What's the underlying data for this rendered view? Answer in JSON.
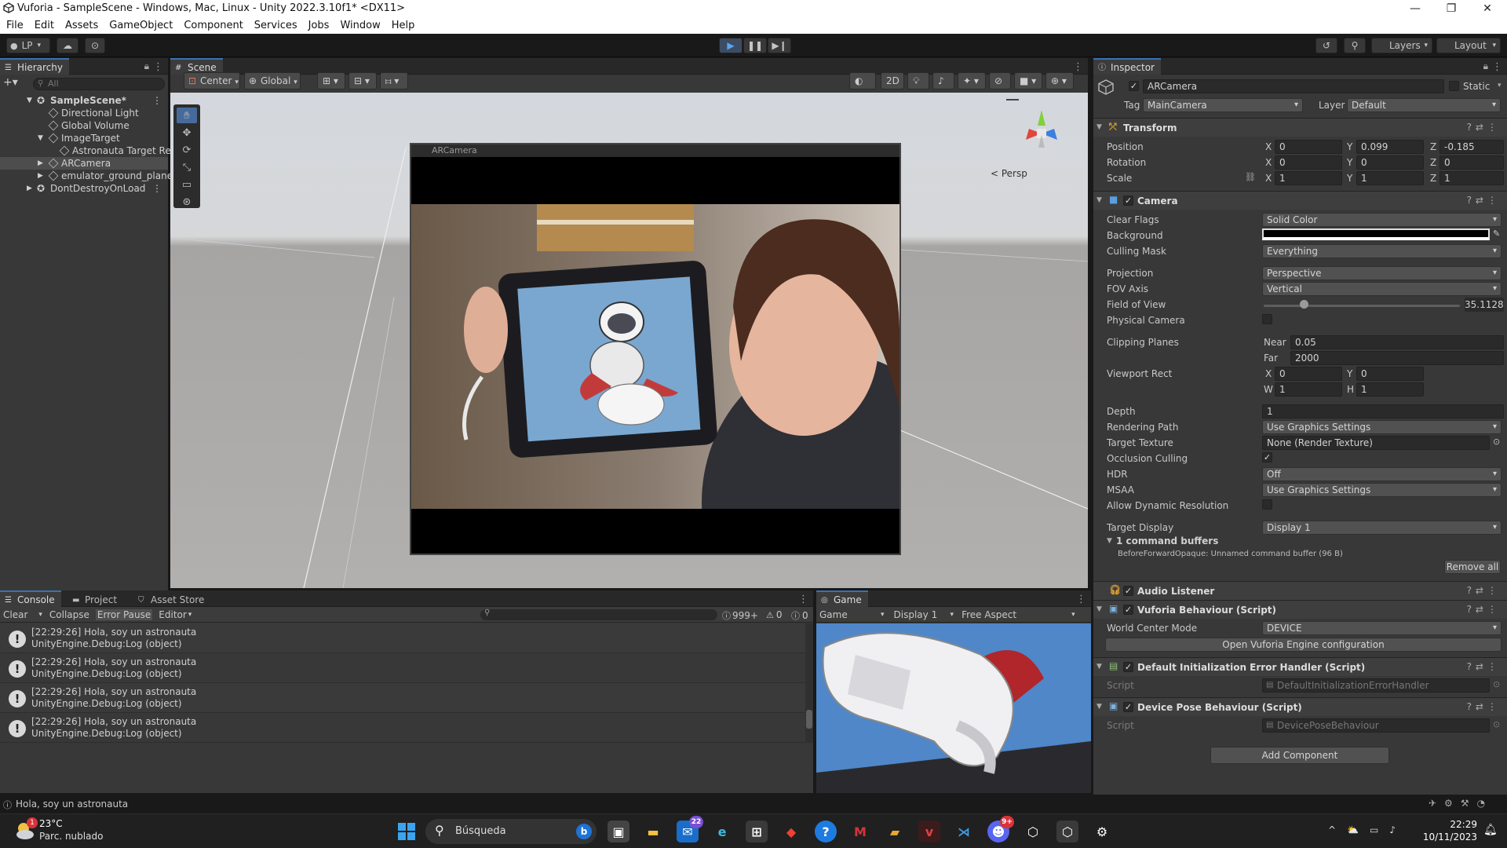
{
  "window": {
    "title": "Vuforia - SampleScene - Windows, Mac, Linux - Unity 2022.3.10f1* <DX11>"
  },
  "menu": [
    "File",
    "Edit",
    "Assets",
    "GameObject",
    "Component",
    "Services",
    "Jobs",
    "Window",
    "Help"
  ],
  "toolbar": {
    "account": "LP",
    "layers": "Layers",
    "layout": "Layout"
  },
  "hierarchy": {
    "tab": "Hierarchy",
    "search_placeholder": "All",
    "items": [
      {
        "label": "SampleScene*"
      },
      {
        "label": "Directional Light"
      },
      {
        "label": "Global Volume"
      },
      {
        "label": "ImageTarget"
      },
      {
        "label": "Astronauta Target Re"
      },
      {
        "label": "ARCamera"
      },
      {
        "label": "emulator_ground_plane"
      },
      {
        "label": "DontDestroyOnLoad"
      }
    ]
  },
  "scene": {
    "tab": "Scene",
    "pivot": "Center",
    "space": "Global",
    "mode2d": "2D",
    "persp": "< Persp",
    "camera_preview_title": "ARCamera"
  },
  "inspector": {
    "tab": "Inspector",
    "object_name": "ARCamera",
    "static_label": "Static",
    "tag_label": "Tag",
    "tag_value": "MainCamera",
    "layer_label": "Layer",
    "layer_value": "Default",
    "transform": {
      "title": "Transform",
      "position_label": "Position",
      "rotation_label": "Rotation",
      "scale_label": "Scale",
      "position": {
        "x": "0",
        "y": "0.099",
        "z": "-0.185"
      },
      "rotation": {
        "x": "0",
        "y": "0",
        "z": "0"
      },
      "scale": {
        "x": "1",
        "y": "1",
        "z": "1"
      }
    },
    "camera": {
      "title": "Camera",
      "clear_flags_label": "Clear Flags",
      "clear_flags": "Solid Color",
      "background_label": "Background",
      "culling_mask_label": "Culling Mask",
      "culling_mask": "Everything",
      "projection_label": "Projection",
      "projection": "Perspective",
      "fov_axis_label": "FOV Axis",
      "fov_axis": "Vertical",
      "fov_label": "Field of View",
      "fov": "35.1128",
      "physical_label": "Physical Camera",
      "clipping_label": "Clipping Planes",
      "near_label": "Near",
      "near": "0.05",
      "far_label": "Far",
      "far": "2000",
      "viewport_label": "Viewport Rect",
      "vx": "0",
      "vy": "0",
      "vw": "1",
      "vh": "1",
      "depth_label": "Depth",
      "depth": "1",
      "render_path_label": "Rendering Path",
      "render_path": "Use Graphics Settings",
      "target_texture_label": "Target Texture",
      "target_texture": "None (Render Texture)",
      "occlusion_label": "Occlusion Culling",
      "hdr_label": "HDR",
      "hdr": "Off",
      "msaa_label": "MSAA",
      "msaa": "Use Graphics Settings",
      "dynamic_res_label": "Allow Dynamic Resolution",
      "target_display_label": "Target Display",
      "target_display": "Display 1",
      "cmd_buffers": "1 command buffers",
      "cmd_buffer_item": "BeforeForwardOpaque: Unnamed command buffer (96 B)",
      "remove_all": "Remove all"
    },
    "audio_listener": "Audio Listener",
    "vuforia": {
      "title": "Vuforia Behaviour (Script)",
      "wcm_label": "World Center Mode",
      "wcm": "DEVICE",
      "open_config": "Open Vuforia Engine configuration"
    },
    "error_handler": {
      "title": "Default Initialization Error Handler (Script)",
      "script_label": "Script",
      "script": "DefaultInitializationErrorHandler"
    },
    "device_pose": {
      "title": "Device Pose Behaviour (Script)",
      "script_label": "Script",
      "script": "DevicePoseBehaviour"
    },
    "add_component": "Add Component"
  },
  "console": {
    "tabs": [
      "Console",
      "Project",
      "Asset Store"
    ],
    "toolbar": {
      "clear": "Clear",
      "collapse": "Collapse",
      "error_pause": "Error Pause",
      "editor": "Editor"
    },
    "counts": {
      "logs": "999+",
      "warnings": "0",
      "errors": "0"
    },
    "entries": [
      {
        "line1": "[22:29:26] Hola, soy un astronauta",
        "line2": "UnityEngine.Debug:Log (object)"
      },
      {
        "line1": "[22:29:26] Hola, soy un astronauta",
        "line2": "UnityEngine.Debug:Log (object)"
      },
      {
        "line1": "[22:29:26] Hola, soy un astronauta",
        "line2": "UnityEngine.Debug:Log (object)"
      },
      {
        "line1": "[22:29:26] Hola, soy un astronauta",
        "line2": "UnityEngine.Debug:Log (object)"
      }
    ]
  },
  "game": {
    "tab": "Game",
    "mode": "Game",
    "display": "Display 1",
    "aspect": "Free Aspect"
  },
  "status": {
    "message": "Hola, soy un astronauta"
  },
  "taskbar": {
    "weather_temp": "23°C",
    "weather_desc": "Parc. nublado",
    "weather_badge": "1",
    "search": "Búsqueda",
    "mail_badge": "22",
    "discord_badge": "9+",
    "time": "22:29",
    "date": "10/11/2023"
  },
  "colors": {
    "accent": "#3a72b0",
    "panel": "#383838",
    "toolbar": "#191919"
  }
}
